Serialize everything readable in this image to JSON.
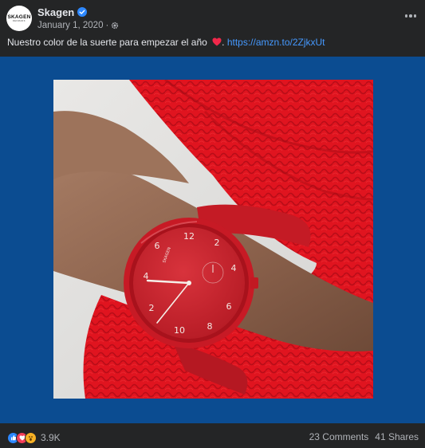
{
  "post": {
    "page_name": "Skagen",
    "avatar_brand": "SKAGEN",
    "avatar_brand_sub": "DENMARK",
    "date": "January 1, 2020",
    "meta_separator": "·",
    "caption_text": "Nuestro color de la suerte para empezar el año ",
    "caption_after_emoji": ". ",
    "caption_link": "https://amzn.to/2ZjkxUt",
    "verified_icon": "verified-badge-icon",
    "audience_icon": "gear-icon",
    "more_icon": "more-options-icon"
  },
  "footer": {
    "reaction_count": "3.9K",
    "comments": "23 Comments",
    "shares": "41 Shares"
  },
  "colors": {
    "background": "#242526",
    "media_background": "#0b4c91",
    "link": "#4599ff",
    "sweater": "#e0141f",
    "watch": "#d3222c"
  }
}
